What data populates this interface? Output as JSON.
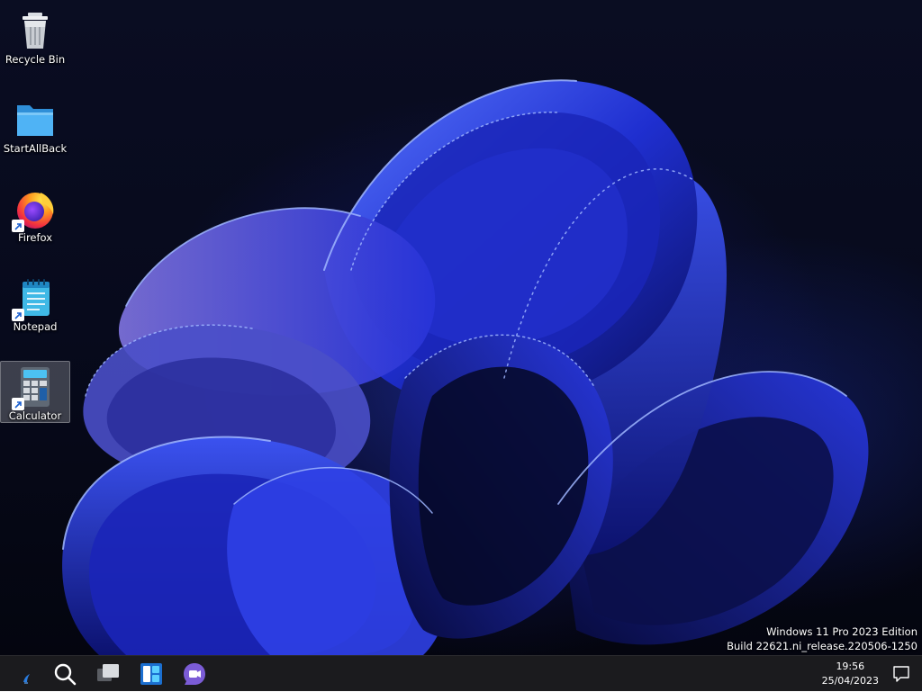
{
  "desktop": {
    "icons": [
      {
        "label": "Recycle Bin",
        "icon": "recycle-bin-icon",
        "shortcut": false,
        "selected": false
      },
      {
        "label": "StartAllBack",
        "icon": "folder-icon",
        "shortcut": false,
        "selected": false
      },
      {
        "label": "Firefox",
        "icon": "firefox-icon",
        "shortcut": true,
        "selected": false
      },
      {
        "label": "Notepad",
        "icon": "notepad-icon",
        "shortcut": true,
        "selected": false
      },
      {
        "label": "Calculator",
        "icon": "calculator-icon",
        "shortcut": true,
        "selected": true
      }
    ],
    "watermark": {
      "line1": "Windows 11 Pro 2023 Edition",
      "line2": "Build 22621.ni_release.220506-1250"
    }
  },
  "taskbar": {
    "buttons": [
      "start-button",
      "search-button",
      "task-view-button",
      "widgets-button",
      "chat-button"
    ],
    "clock": {
      "time": "19:56",
      "date": "25/04/2023"
    }
  },
  "colors": {
    "taskbar_bg": "#1b1b1e",
    "wallpaper_accent": "#2a3cff",
    "folder": "#3ea7f0"
  }
}
